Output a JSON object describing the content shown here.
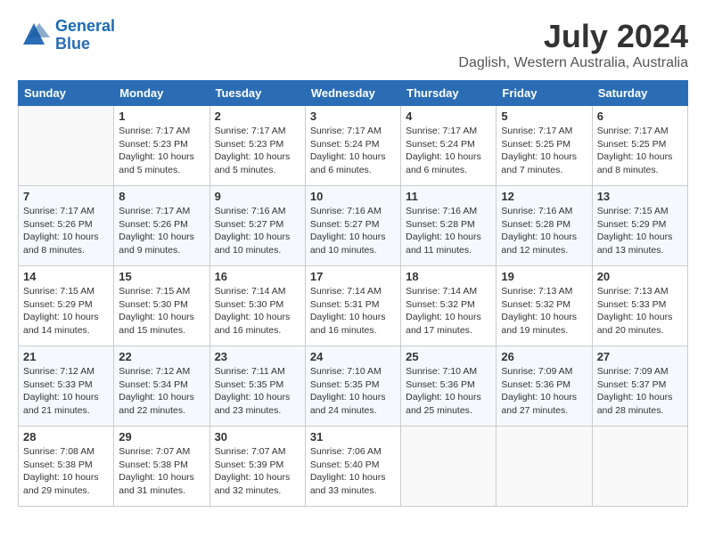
{
  "header": {
    "logo_line1": "General",
    "logo_line2": "Blue",
    "title": "July 2024",
    "subtitle": "Daglish, Western Australia, Australia"
  },
  "days_of_week": [
    "Sunday",
    "Monday",
    "Tuesday",
    "Wednesday",
    "Thursday",
    "Friday",
    "Saturday"
  ],
  "weeks": [
    [
      {
        "day": "",
        "info": ""
      },
      {
        "day": "1",
        "info": "Sunrise: 7:17 AM\nSunset: 5:23 PM\nDaylight: 10 hours\nand 5 minutes."
      },
      {
        "day": "2",
        "info": "Sunrise: 7:17 AM\nSunset: 5:23 PM\nDaylight: 10 hours\nand 5 minutes."
      },
      {
        "day": "3",
        "info": "Sunrise: 7:17 AM\nSunset: 5:24 PM\nDaylight: 10 hours\nand 6 minutes."
      },
      {
        "day": "4",
        "info": "Sunrise: 7:17 AM\nSunset: 5:24 PM\nDaylight: 10 hours\nand 6 minutes."
      },
      {
        "day": "5",
        "info": "Sunrise: 7:17 AM\nSunset: 5:25 PM\nDaylight: 10 hours\nand 7 minutes."
      },
      {
        "day": "6",
        "info": "Sunrise: 7:17 AM\nSunset: 5:25 PM\nDaylight: 10 hours\nand 8 minutes."
      }
    ],
    [
      {
        "day": "7",
        "info": "Sunrise: 7:17 AM\nSunset: 5:26 PM\nDaylight: 10 hours\nand 8 minutes."
      },
      {
        "day": "8",
        "info": "Sunrise: 7:17 AM\nSunset: 5:26 PM\nDaylight: 10 hours\nand 9 minutes."
      },
      {
        "day": "9",
        "info": "Sunrise: 7:16 AM\nSunset: 5:27 PM\nDaylight: 10 hours\nand 10 minutes."
      },
      {
        "day": "10",
        "info": "Sunrise: 7:16 AM\nSunset: 5:27 PM\nDaylight: 10 hours\nand 10 minutes."
      },
      {
        "day": "11",
        "info": "Sunrise: 7:16 AM\nSunset: 5:28 PM\nDaylight: 10 hours\nand 11 minutes."
      },
      {
        "day": "12",
        "info": "Sunrise: 7:16 AM\nSunset: 5:28 PM\nDaylight: 10 hours\nand 12 minutes."
      },
      {
        "day": "13",
        "info": "Sunrise: 7:15 AM\nSunset: 5:29 PM\nDaylight: 10 hours\nand 13 minutes."
      }
    ],
    [
      {
        "day": "14",
        "info": "Sunrise: 7:15 AM\nSunset: 5:29 PM\nDaylight: 10 hours\nand 14 minutes."
      },
      {
        "day": "15",
        "info": "Sunrise: 7:15 AM\nSunset: 5:30 PM\nDaylight: 10 hours\nand 15 minutes."
      },
      {
        "day": "16",
        "info": "Sunrise: 7:14 AM\nSunset: 5:30 PM\nDaylight: 10 hours\nand 16 minutes."
      },
      {
        "day": "17",
        "info": "Sunrise: 7:14 AM\nSunset: 5:31 PM\nDaylight: 10 hours\nand 16 minutes."
      },
      {
        "day": "18",
        "info": "Sunrise: 7:14 AM\nSunset: 5:32 PM\nDaylight: 10 hours\nand 17 minutes."
      },
      {
        "day": "19",
        "info": "Sunrise: 7:13 AM\nSunset: 5:32 PM\nDaylight: 10 hours\nand 19 minutes."
      },
      {
        "day": "20",
        "info": "Sunrise: 7:13 AM\nSunset: 5:33 PM\nDaylight: 10 hours\nand 20 minutes."
      }
    ],
    [
      {
        "day": "21",
        "info": "Sunrise: 7:12 AM\nSunset: 5:33 PM\nDaylight: 10 hours\nand 21 minutes."
      },
      {
        "day": "22",
        "info": "Sunrise: 7:12 AM\nSunset: 5:34 PM\nDaylight: 10 hours\nand 22 minutes."
      },
      {
        "day": "23",
        "info": "Sunrise: 7:11 AM\nSunset: 5:35 PM\nDaylight: 10 hours\nand 23 minutes."
      },
      {
        "day": "24",
        "info": "Sunrise: 7:10 AM\nSunset: 5:35 PM\nDaylight: 10 hours\nand 24 minutes."
      },
      {
        "day": "25",
        "info": "Sunrise: 7:10 AM\nSunset: 5:36 PM\nDaylight: 10 hours\nand 25 minutes."
      },
      {
        "day": "26",
        "info": "Sunrise: 7:09 AM\nSunset: 5:36 PM\nDaylight: 10 hours\nand 27 minutes."
      },
      {
        "day": "27",
        "info": "Sunrise: 7:09 AM\nSunset: 5:37 PM\nDaylight: 10 hours\nand 28 minutes."
      }
    ],
    [
      {
        "day": "28",
        "info": "Sunrise: 7:08 AM\nSunset: 5:38 PM\nDaylight: 10 hours\nand 29 minutes."
      },
      {
        "day": "29",
        "info": "Sunrise: 7:07 AM\nSunset: 5:38 PM\nDaylight: 10 hours\nand 31 minutes."
      },
      {
        "day": "30",
        "info": "Sunrise: 7:07 AM\nSunset: 5:39 PM\nDaylight: 10 hours\nand 32 minutes."
      },
      {
        "day": "31",
        "info": "Sunrise: 7:06 AM\nSunset: 5:40 PM\nDaylight: 10 hours\nand 33 minutes."
      },
      {
        "day": "",
        "info": ""
      },
      {
        "day": "",
        "info": ""
      },
      {
        "day": "",
        "info": ""
      }
    ]
  ]
}
